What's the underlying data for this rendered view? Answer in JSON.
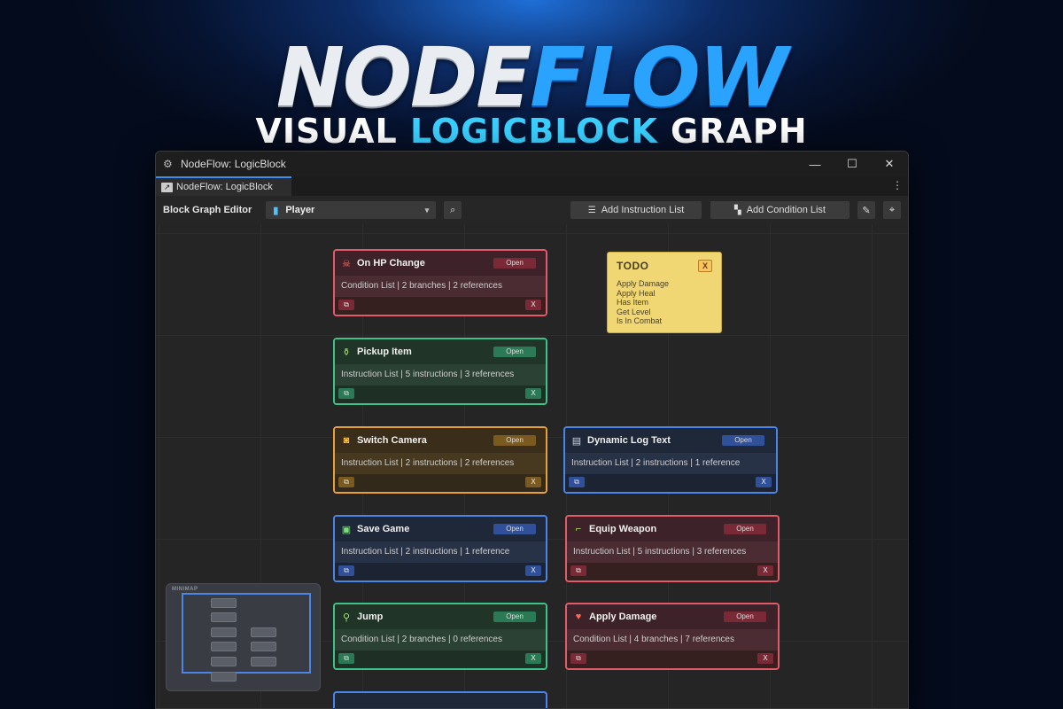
{
  "hero": {
    "title_a": "NODE",
    "title_b": "FLOW",
    "subtitle_a": "VISUAL ",
    "subtitle_hl": "LOGICBLOCK",
    "subtitle_b": " GRAPH"
  },
  "window": {
    "title": "NodeFlow: LogicBlock",
    "minimize_glyph": "—",
    "maximize_glyph": "☐",
    "close_glyph": "✕"
  },
  "tab": {
    "label": "NodeFlow: LogicBlock"
  },
  "toolbar": {
    "label": "Block Graph Editor",
    "select_value": "Player",
    "add_instruction_label": "Add Instruction List",
    "add_condition_label": "Add Condition List"
  },
  "nodes": [
    {
      "title": "On HP Change",
      "open": "Open",
      "summary": "Condition List | 2 branches | 2 references",
      "icon": "skull-icon",
      "glyph": "☠",
      "color": "red",
      "x": "X"
    },
    {
      "title": "Pickup Item",
      "open": "Open",
      "summary": "Instruction List | 5 instructions | 3 references",
      "icon": "potion-icon",
      "glyph": "⚱",
      "color": "green",
      "x": "X"
    },
    {
      "title": "Switch Camera",
      "open": "Open",
      "summary": "Instruction List | 2 instructions | 2 references",
      "icon": "camera-icon",
      "glyph": "◙",
      "color": "orange",
      "x": "X"
    },
    {
      "title": "Dynamic Log Text",
      "open": "Open",
      "summary": "Instruction List | 2 instructions | 1 reference",
      "icon": "document-icon",
      "glyph": "▤",
      "color": "blue",
      "x": "X"
    },
    {
      "title": "Save Game",
      "open": "Open",
      "summary": "Instruction List | 2 instructions | 1 reference",
      "icon": "floppy-icon",
      "glyph": "▣",
      "color": "blue",
      "x": "X"
    },
    {
      "title": "Equip Weapon",
      "open": "Open",
      "summary": "Instruction List | 5 instructions | 3 references",
      "icon": "gun-icon",
      "glyph": "⌐",
      "color": "red",
      "x": "X"
    },
    {
      "title": "Jump",
      "open": "Open",
      "summary": "Condition List | 2 branches | 0 references",
      "icon": "running-icon",
      "glyph": "⚲",
      "color": "green",
      "x": "X"
    },
    {
      "title": "Apply Damage",
      "open": "Open",
      "summary": "Condition List | 4 branches | 7 references",
      "icon": "heart-icon",
      "glyph": "♥",
      "color": "red",
      "x": "X"
    }
  ],
  "todo": {
    "title": "TODO",
    "close": "X",
    "items": [
      "Apply Damage",
      "Apply Heal",
      "Has Item",
      "Get Level",
      "Is In Combat"
    ]
  },
  "minimap": {
    "label": "MINIMAP"
  }
}
